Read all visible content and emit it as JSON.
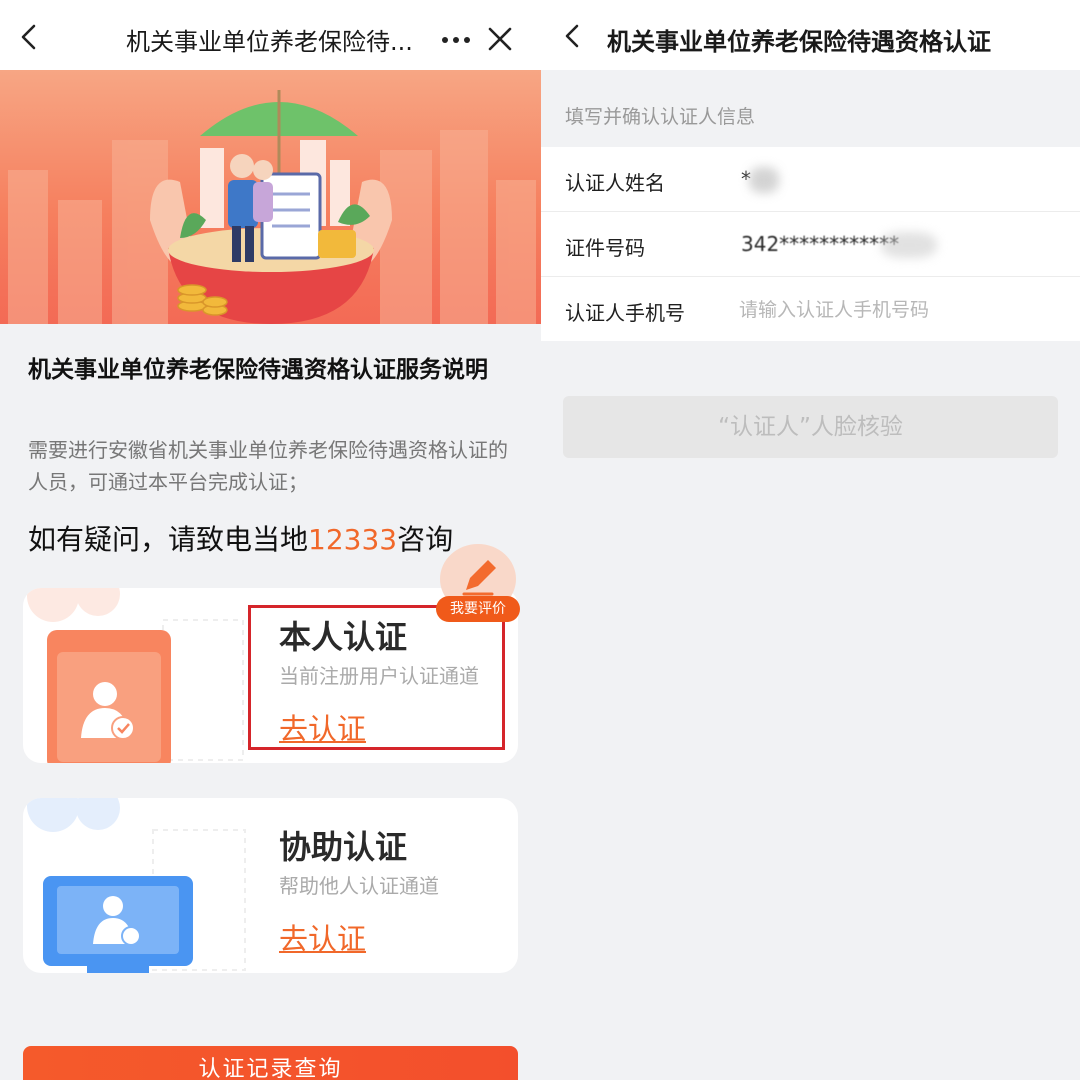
{
  "left": {
    "nav": {
      "title": "机关事业单位养老保险待..."
    },
    "intro": {
      "heading": "机关事业单位养老保险待遇资格认证服务说明",
      "description": "需要进行安徽省机关事业单位养老保险待遇资格认证的人员，可通过本平台完成认证；",
      "hotline_prefix": "如有疑问，请致电当地",
      "hotline_number": "12333",
      "hotline_suffix": "咨询"
    },
    "cards": [
      {
        "title": "本人认证",
        "subtitle": "当前注册用户认证通道",
        "action": "去认证"
      },
      {
        "title": "协助认证",
        "subtitle": "帮助他人认证通道",
        "action": "去认证"
      }
    ],
    "fab": {
      "label": "我要评价"
    },
    "bottom_button": "认证记录查询",
    "colors": {
      "accent": "#f1682a",
      "highlight_box": "#d5252a"
    }
  },
  "right": {
    "nav": {
      "title": "机关事业单位养老保险待遇资格认证"
    },
    "section_hint": "填写并确认认证人信息",
    "form": {
      "name_label": "认证人姓名",
      "name_value": "*",
      "id_label": "证件号码",
      "id_value": "342************",
      "phone_label": "认证人手机号",
      "phone_placeholder": "请输入认证人手机号码"
    },
    "face_button": "“认证人”人脸核验"
  }
}
